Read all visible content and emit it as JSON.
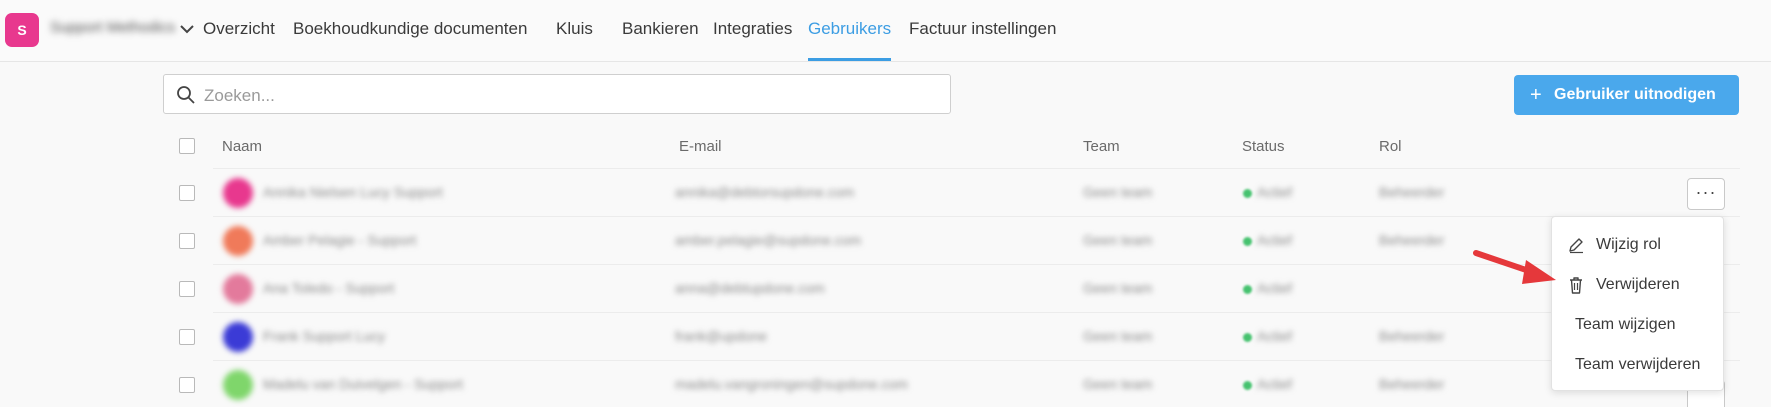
{
  "org": {
    "initial": "S",
    "name": "Support Methodics"
  },
  "nav": {
    "items": [
      "Overzicht",
      "Boekhoudkundige documenten",
      "Kluis",
      "Bankieren",
      "Integraties",
      "Gebruikers",
      "Factuur instellingen"
    ],
    "active": "Gebruikers"
  },
  "search": {
    "placeholder": "Zoeken..."
  },
  "invite_button": {
    "icon": "+",
    "label": "Gebruiker uitnodigen"
  },
  "table": {
    "headers": {
      "name": "Naam",
      "email": "E-mail",
      "team": "Team",
      "status": "Status",
      "role": "Rol"
    },
    "rows": [
      {
        "name": "Annika Nielsen Lucy Support",
        "email": "annika@debtorsupdone.com",
        "team": "Geen team",
        "status": "Actief",
        "role": "Beheerder",
        "avatar_color": "#e8388e"
      },
      {
        "name": "Amber Pelagie - Support",
        "email": "amber.pelagie@supdone.com",
        "team": "Geen team",
        "status": "Actief",
        "role": "Beheerder",
        "avatar_color": "#f07a5a"
      },
      {
        "name": "Ana Toledo - Support",
        "email": "anna@debtupdone.com",
        "team": "Geen team",
        "status": "Actief",
        "role": "",
        "avatar_color": "#e37a9c"
      },
      {
        "name": "Frank Support Lucy",
        "email": "frank@updone",
        "team": "Geen team",
        "status": "Actief",
        "role": "Beheerder",
        "avatar_color": "#3b3bd6"
      },
      {
        "name": "Madelu van Duivelgen - Support",
        "email": "madelu.vangroningen@supdone.com",
        "team": "Geen team",
        "status": "Actief",
        "role": "Beheerder",
        "avatar_color": "#7fd66b"
      }
    ]
  },
  "row_actions": {
    "more_label": "···"
  },
  "menu": {
    "items": [
      {
        "label": "Wijzig rol",
        "icon": "pencil-icon"
      },
      {
        "label": "Verwijderen",
        "icon": "trash-icon"
      },
      {
        "label": "Team wijzigen",
        "icon": ""
      },
      {
        "label": "Team verwijderen",
        "icon": ""
      }
    ]
  },
  "colors": {
    "accent": "#3c9de3",
    "button": "#4aa8ec",
    "badge": "#e8388e",
    "arrow": "#e5383b",
    "status_active": "#46c26f"
  }
}
